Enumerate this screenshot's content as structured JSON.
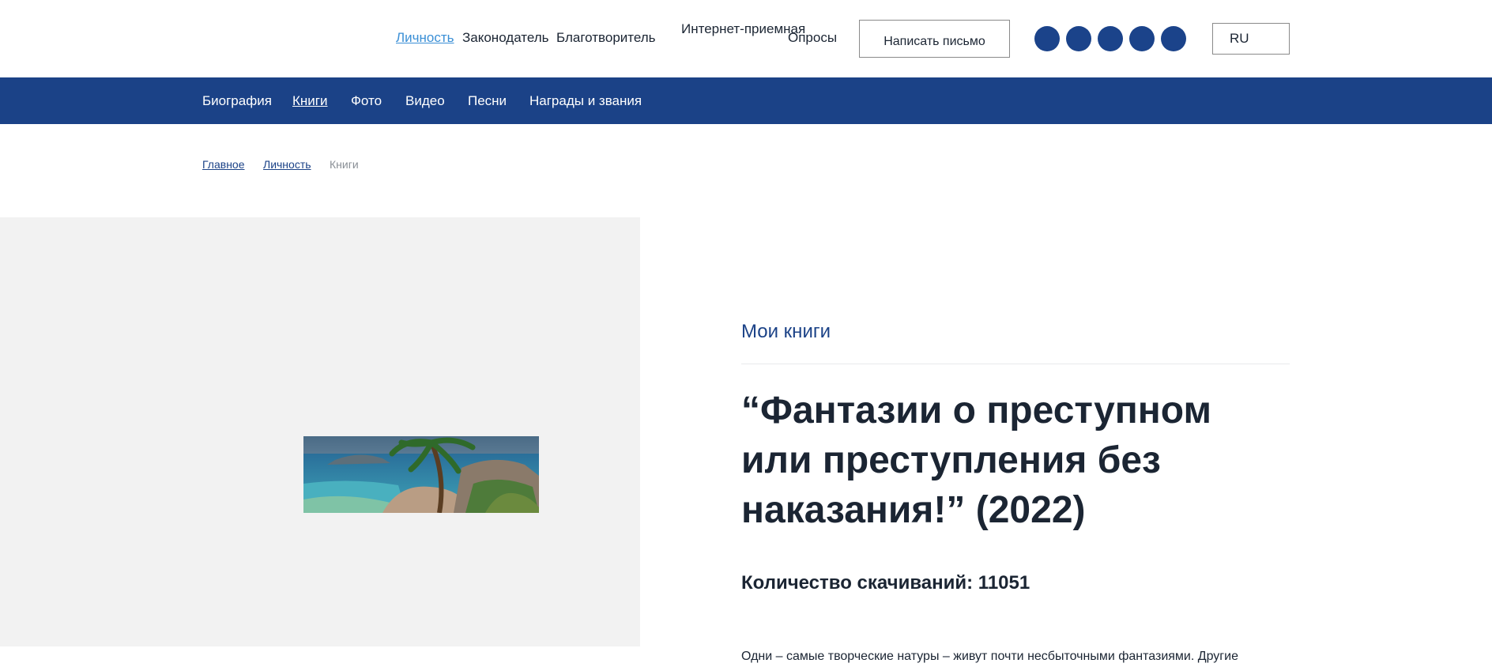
{
  "header": {
    "top_nav": [
      {
        "label": "Личность"
      },
      {
        "label": "Законодатель"
      },
      {
        "label": "Благотворитель"
      },
      {
        "label": "Интернет-приемная"
      },
      {
        "label": "Опросы"
      }
    ],
    "write_button": "Написать письмо",
    "language": "RU"
  },
  "main_nav": [
    {
      "label": "Биография"
    },
    {
      "label": "Книги"
    },
    {
      "label": "Фото"
    },
    {
      "label": "Видео"
    },
    {
      "label": "Песни"
    },
    {
      "label": "Награды и звания"
    }
  ],
  "breadcrumb": [
    {
      "label": "Главное"
    },
    {
      "label": "Личность"
    },
    {
      "label": "Книги"
    }
  ],
  "content": {
    "section_label": "Мои книги",
    "book_title": "“Фантазии о преступном или преступления без наказания!” (2022)",
    "downloads": "Количество скачиваний: 11051",
    "description": "Одни – самые творческие натуры – живут почти несбыточными фантазиями. Другие"
  },
  "colors": {
    "brand_blue": "#1b4287",
    "active_link": "#3a8fd6",
    "panel_grey": "#f2f2f2",
    "text_dark": "#1b2533"
  }
}
